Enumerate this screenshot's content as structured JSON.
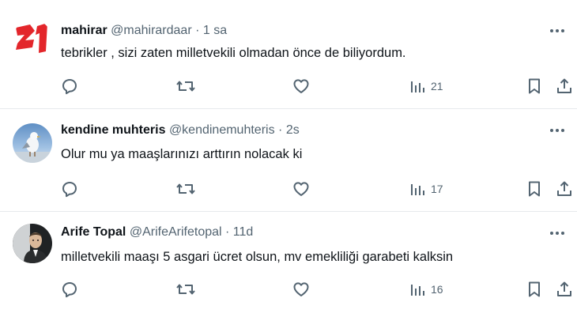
{
  "tweets": [
    {
      "display_name": "mahirar",
      "handle": "@mahirardaar",
      "separator": "·",
      "time": "1 sa",
      "text": "tebrikler , sizi zaten milletvekili olmadan önce de biliyordum.",
      "views": "21",
      "avatar": "logo-21-avatar"
    },
    {
      "display_name": "kendine muhteris",
      "handle": "@kendinemuhteris",
      "separator": "·",
      "time": "2s",
      "text": "Olur mu ya maaşlarınızı arttırın nolacak ki",
      "views": "17",
      "avatar": "seagull-photo-avatar"
    },
    {
      "display_name": "Arife Topal",
      "handle": "@ArifeArifetopal",
      "separator": "·",
      "time": "11d",
      "text": "milletvekili maaşı 5 asgari ücret olsun, mv emekliliği garabeti kalksin",
      "views": "16",
      "avatar": "ataturk-photo-avatar"
    }
  ],
  "colors": {
    "text": "#0f1419",
    "secondary": "#536471",
    "divider": "#e6eaed",
    "logo_red": "#e3262b"
  },
  "icons": [
    "more-icon",
    "reply-icon",
    "retweet-icon",
    "like-icon",
    "views-icon",
    "bookmark-icon",
    "share-icon"
  ]
}
